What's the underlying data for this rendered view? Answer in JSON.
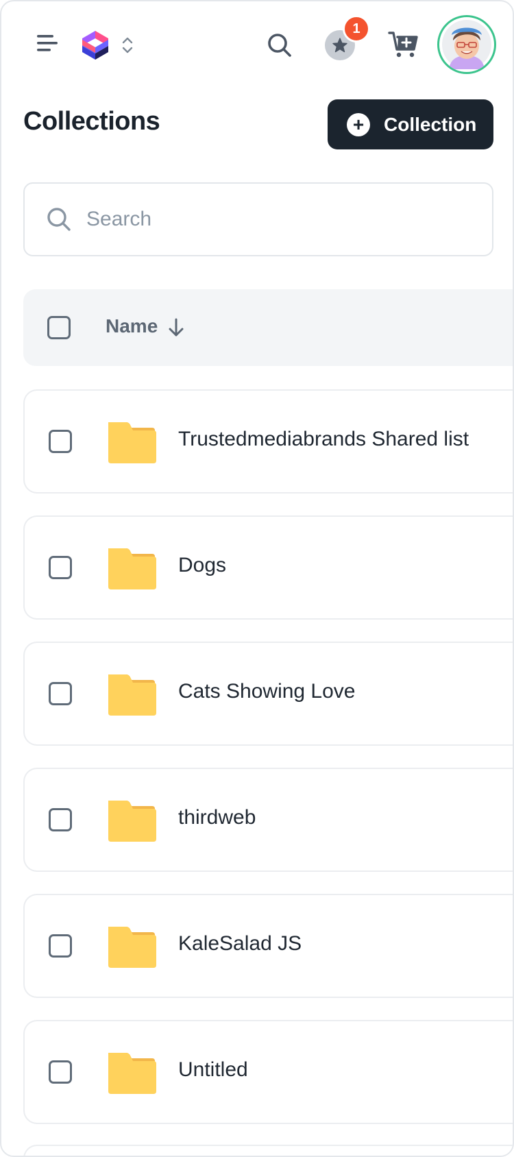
{
  "header": {
    "menu_icon": "hamburger-menu-icon",
    "logo_icon": "app-logo-icon",
    "switcher_icon": "chevron-up-down-icon",
    "search_icon": "search-icon",
    "favorites_icon": "star-icon",
    "favorites_badge": "1",
    "cart_icon": "cart-add-icon",
    "avatar_icon": "user-avatar",
    "accent_badge_color": "#f4532e",
    "avatar_ring_color": "#3cc48d"
  },
  "page": {
    "title": "Collections",
    "new_collection_label": "Collection"
  },
  "search": {
    "placeholder": "Search",
    "value": ""
  },
  "table": {
    "column_name": "Name",
    "sort_icon": "arrow-down-icon",
    "rows": [
      {
        "label": "Trustedmediabrands Shared list",
        "icon": "folder-icon"
      },
      {
        "label": "Dogs",
        "icon": "folder-icon"
      },
      {
        "label": "Cats Showing Love",
        "icon": "folder-icon"
      },
      {
        "label": "thirdweb",
        "icon": "folder-icon"
      },
      {
        "label": "KaleSalad JS",
        "icon": "folder-icon"
      },
      {
        "label": "Untitled",
        "icon": "folder-icon"
      }
    ]
  },
  "colors": {
    "primary_button": "#1b242e",
    "folder": "#ffd25c",
    "folder_tab": "#f2b64a"
  }
}
